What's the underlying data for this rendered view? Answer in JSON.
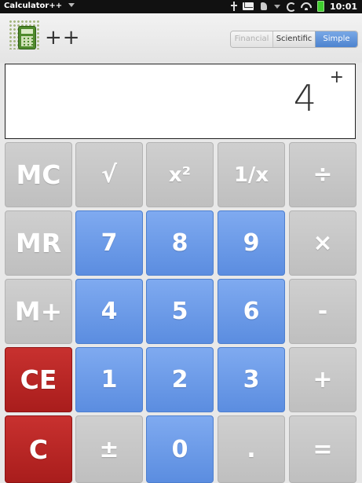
{
  "status_bar": {
    "app_menu_label": "Calculator++",
    "time": "10:01",
    "icons": [
      "usb-icon",
      "mail-icon",
      "notify-icon",
      "sync-icon",
      "wifi-icon",
      "battery-icon"
    ]
  },
  "header": {
    "title": "++",
    "logo_icon": "calculator-icon",
    "modes": [
      {
        "label": "Financial",
        "state": "disabled"
      },
      {
        "label": "Scientific",
        "state": "normal"
      },
      {
        "label": "Simple",
        "state": "selected"
      }
    ]
  },
  "display": {
    "value": "4",
    "operator": "+"
  },
  "keys": {
    "mc": "MC",
    "sqrt": "√",
    "square": "x²",
    "reciprocal": "1/x",
    "divide": "÷",
    "mr": "MR",
    "seven": "7",
    "eight": "8",
    "nine": "9",
    "multiply": "×",
    "m_plus": "M+",
    "four": "4",
    "five": "5",
    "six": "6",
    "minus": "-",
    "ce": "CE",
    "one": "1",
    "two": "2",
    "three": "3",
    "plus": "+",
    "c": "C",
    "plus_minus": "±",
    "zero": "0",
    "decimal": ".",
    "equals": "="
  },
  "colors": {
    "gray_key": "#c6c6c6",
    "blue_key": "#6b9be8",
    "red_key": "#b72523",
    "mode_selected": "#5b8fd6"
  }
}
